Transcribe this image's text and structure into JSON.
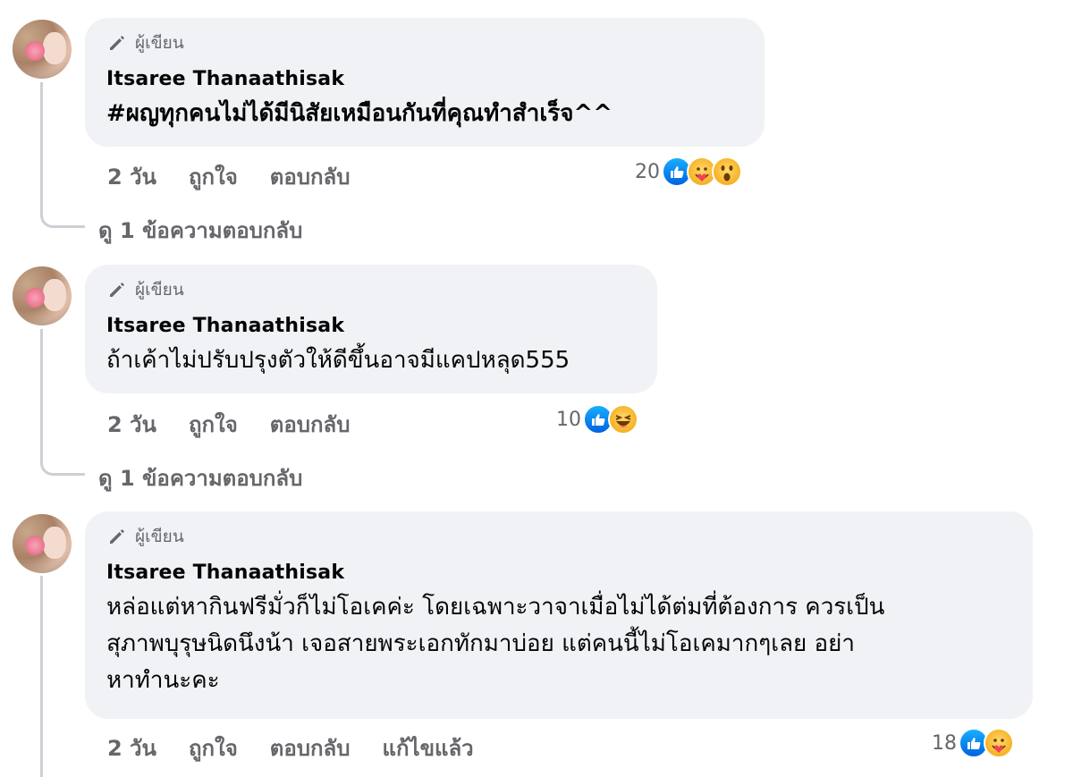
{
  "comments": [
    {
      "badge": "ผู้เขียน",
      "name": "Itsaree Thanaathisak",
      "text": "#ผญทุกคนไม่ได้มีนิสัยเหมือนกันที่คุณทำสำเร็จ^^",
      "time": "2 วัน",
      "like": "ถูกใจ",
      "reply": "ตอบกลับ",
      "reaction_count": "20",
      "reactions": [
        "like-icon",
        "care-icon",
        "wow-icon"
      ],
      "view_replies": "ดู 1 ข้อความตอบกลับ"
    },
    {
      "badge": "ผู้เขียน",
      "name": "Itsaree Thanaathisak",
      "text": "ถ้าเค้าไม่ปรับปรุงตัวให้ดีขึ้นอาจมีแคปหลุด555",
      "time": "2 วัน",
      "like": "ถูกใจ",
      "reply": "ตอบกลับ",
      "reaction_count": "10",
      "reactions": [
        "like-icon",
        "haha-icon"
      ],
      "view_replies": "ดู 1 ข้อความตอบกลับ"
    },
    {
      "badge": "ผู้เขียน",
      "name": "Itsaree Thanaathisak",
      "text_lines": [
        "หล่อแต่หากินฟรีมั่วก็ไม่โอเคค่ะ โดยเฉพาะวาจาเมื่อไม่ได้ต่มที่ต้องการ ควรเป็น",
        "สุภาพบุรุษนิดนึงน้า เจอสายพระเอกทักมาบ่อย แต่คนนี้ไม่โอเคมากๆเลย อย่า",
        "หาทำนะคะ"
      ],
      "time": "2 วัน",
      "like": "ถูกใจ",
      "reply": "ตอบกลับ",
      "edited": "แก้ไขแล้ว",
      "reaction_count": "18",
      "reactions": [
        "like-icon",
        "care-icon"
      ]
    }
  ],
  "colors": {
    "bubble": "#f0f2f5",
    "secondary_text": "#65676b",
    "like_blue": "#0866ff",
    "reaction_yellow": "#f7b125"
  }
}
